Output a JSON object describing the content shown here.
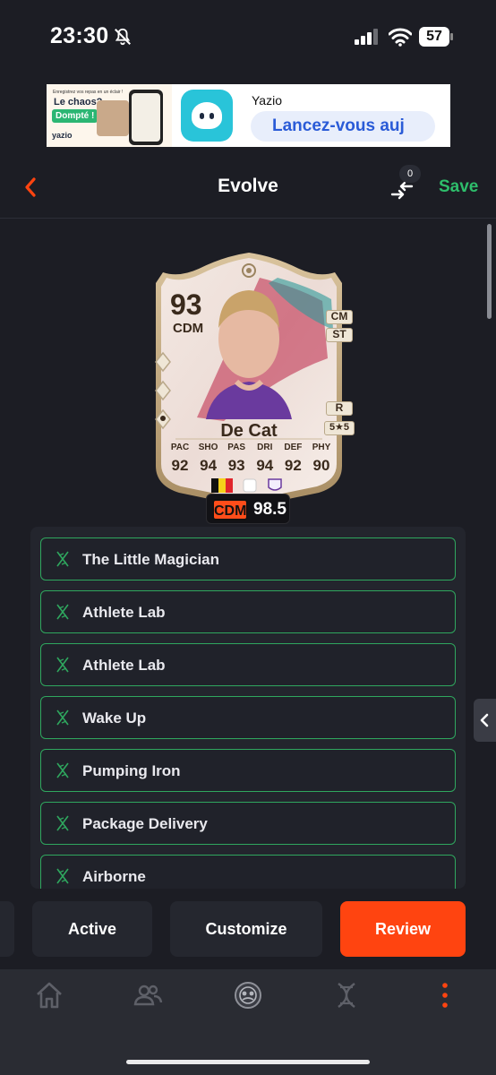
{
  "status_bar": {
    "time": "23:30",
    "battery": "57"
  },
  "ad": {
    "tagline_small": "Enregistrez vos repas en un éclair !",
    "headline": "Le chaos?",
    "highlight": "Dompté !",
    "brand_small": "yazio",
    "app_name": "Yazio",
    "cta": "Lancez-vous auj"
  },
  "header": {
    "title": "Evolve",
    "compare_count": "0",
    "save_label": "Save"
  },
  "card": {
    "rating": "93",
    "position": "CDM",
    "alt_positions": [
      "CM",
      "ST"
    ],
    "name": "De Cat",
    "foot": "R",
    "skills_weakfoot": "5★5",
    "stat_labels": [
      "PAC",
      "SHO",
      "PAS",
      "DRI",
      "DEF",
      "PHY"
    ],
    "stat_values": [
      "92",
      "94",
      "93",
      "94",
      "92",
      "90"
    ],
    "pill_position": "CDM",
    "pill_rating": "98.5"
  },
  "evolutions": [
    "The Little Magician",
    "Athlete Lab",
    "Athlete Lab",
    "Wake Up",
    "Pumping Iron",
    "Package Delivery",
    "Airborne"
  ],
  "actions": {
    "active": "Active",
    "customize": "Customize",
    "review": "Review"
  },
  "colors": {
    "accent_orange": "#ff4410",
    "save_green": "#2ebd6b",
    "evo_border": "#2fa75e"
  },
  "tabbar": [
    "home-icon",
    "friends-icon",
    "club-icon",
    "dna-icon",
    "more-icon"
  ]
}
